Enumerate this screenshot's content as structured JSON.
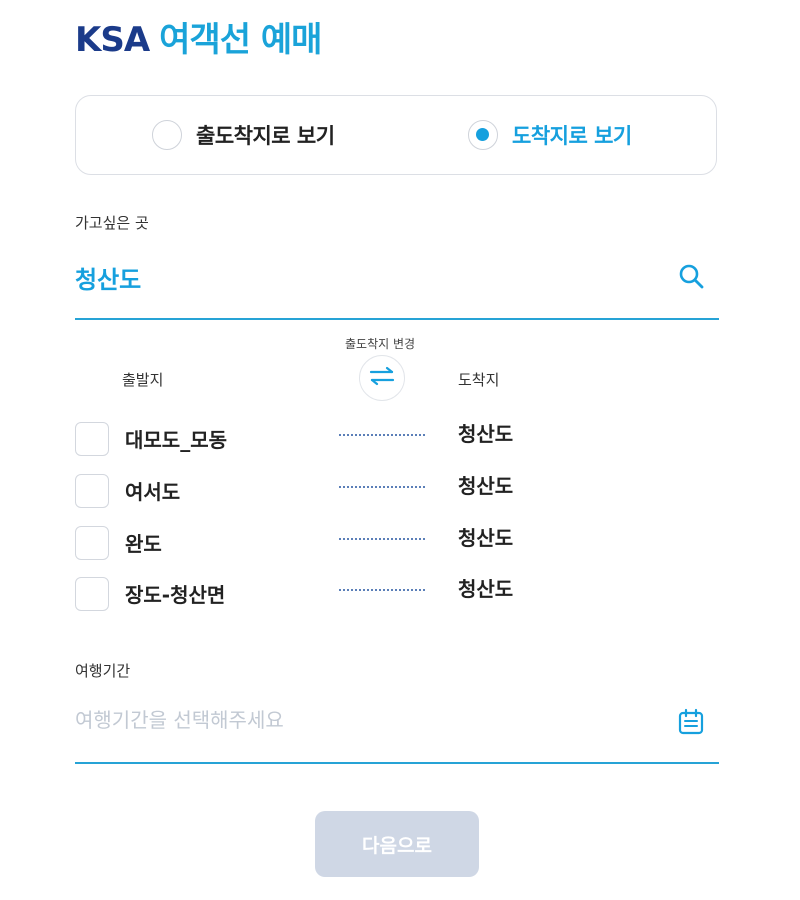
{
  "header": {
    "brand": "KSA",
    "title": "여객선 예매"
  },
  "view_toggle": {
    "options": [
      {
        "label": "출도착지로 보기",
        "selected": false
      },
      {
        "label": "도착지로 보기",
        "selected": true
      }
    ]
  },
  "destination": {
    "label": "가고싶은 곳",
    "value": "청산도",
    "icon": "search-icon"
  },
  "swap": {
    "label": "출도착지 변경",
    "icon": "swap-arrows-icon"
  },
  "routes": {
    "departure_header": "출발지",
    "arrival_header": "도착지",
    "items": [
      {
        "departure": "대모도_모동",
        "arrival": "청산도",
        "checked": false
      },
      {
        "departure": "여서도",
        "arrival": "청산도",
        "checked": false
      },
      {
        "departure": "완도",
        "arrival": "청산도",
        "checked": false
      },
      {
        "departure": "장도-청산면",
        "arrival": "청산도",
        "checked": false
      }
    ]
  },
  "travel_period": {
    "label": "여행기간",
    "value": "",
    "placeholder": "여행기간을 선택해주세요",
    "icon": "calendar-icon"
  },
  "actions": {
    "next_label": "다음으로",
    "enabled": false
  },
  "colors": {
    "brand": "#1b3b8a",
    "accent": "#16a0de",
    "underline": "#26a3d6",
    "disabled_button": "#cfd7e5",
    "placeholder": "#c2c9d3"
  }
}
